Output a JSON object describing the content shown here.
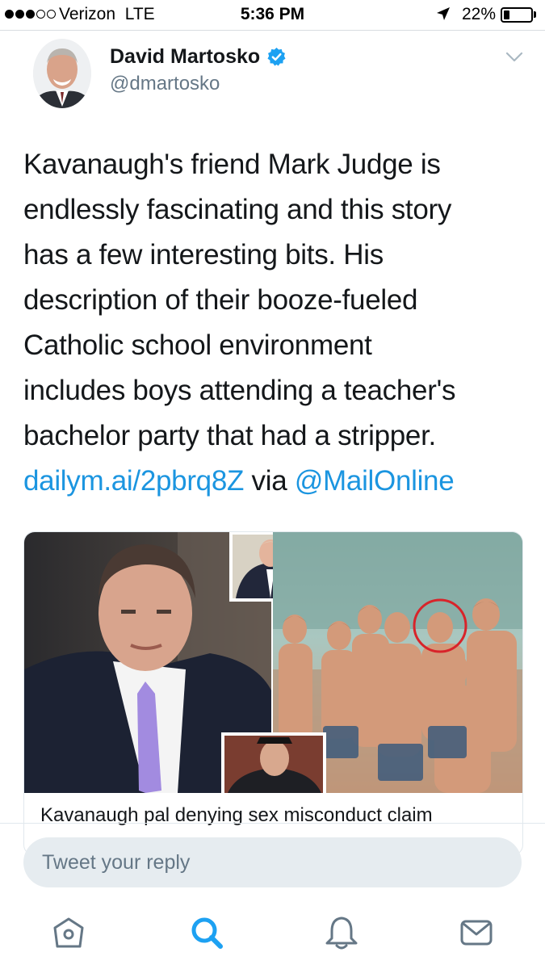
{
  "status_bar": {
    "carrier": "Verizon",
    "network": "LTE",
    "time": "5:36 PM",
    "battery_percent": "22%",
    "battery_level": 0.22,
    "signal_bars_filled": 3,
    "signal_bars_total": 5
  },
  "tweet": {
    "author_name": "David Martosko",
    "author_handle": "@dmartosko",
    "verified": true,
    "text_lines": [
      "Kavanaugh's friend Mark Judge is",
      "endlessly fascinating and this story",
      "has a few interesting bits. His",
      "description of their booze-fueled",
      "Catholic school environment",
      "includes boys attending a teacher's",
      "bachelor party that had a stripper."
    ],
    "link_text": "dailym.ai/2pbrq8Z",
    "via_text": "via",
    "mention_text": "@MailOnline"
  },
  "card": {
    "title": "Kavanaugh pal denying sex misconduct claim"
  },
  "reply": {
    "placeholder": "Tweet your reply"
  },
  "tab_bar": {
    "items": [
      "home-icon",
      "search-icon",
      "notifications-icon",
      "messages-icon"
    ],
    "active": "search-icon"
  },
  "colors": {
    "accent": "#1da1f2",
    "link": "#1b95e0",
    "secondary_text": "#657786",
    "reply_bg": "#e6ecf0"
  }
}
